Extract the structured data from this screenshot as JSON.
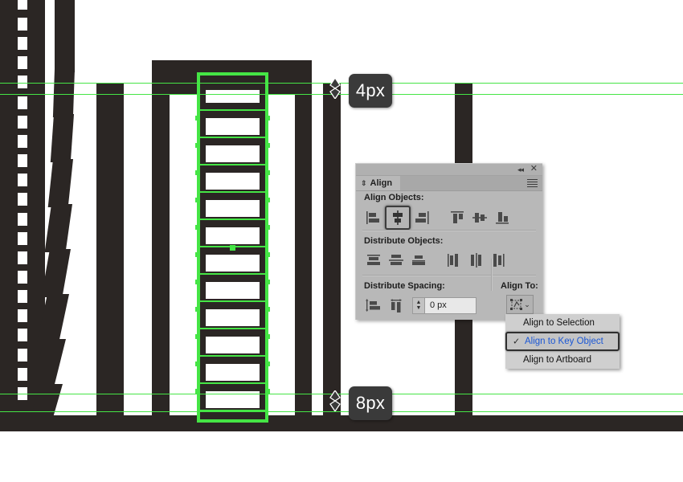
{
  "app": {
    "canvas_background": "#ffffff",
    "artwork_color": "#2b2624",
    "guide_color": "#45e545",
    "selection_color": "#45e545",
    "panel_background": "#b8b8b8",
    "highlight_text_color": "#1a57d6"
  },
  "measurements": [
    {
      "id": "top-gap",
      "value": "4px",
      "icon": "vertical-double-arrow-icon"
    },
    {
      "id": "bottom-gap",
      "value": "8px",
      "icon": "vertical-double-arrow-icon"
    }
  ],
  "panel": {
    "title": "Align",
    "collapse_icon": "collapse-double-chevron-icon",
    "close_icon": "close-icon",
    "menu_icon": "panel-menu-icon",
    "sections": {
      "align_objects": {
        "label": "Align Objects:",
        "buttons": [
          {
            "name": "horizontal-align-left",
            "icon": "align-left-icon",
            "active": false
          },
          {
            "name": "horizontal-align-center",
            "icon": "align-horizontal-center-icon",
            "active": true
          },
          {
            "name": "horizontal-align-right",
            "icon": "align-right-icon",
            "active": false
          },
          {
            "name": "vertical-align-top",
            "icon": "align-top-icon",
            "active": false
          },
          {
            "name": "vertical-align-center",
            "icon": "align-vertical-center-icon",
            "active": false
          },
          {
            "name": "vertical-align-bottom",
            "icon": "align-bottom-icon",
            "active": false
          }
        ]
      },
      "distribute_objects": {
        "label": "Distribute Objects:",
        "buttons": [
          {
            "name": "vertical-distribute-top",
            "icon": "distribute-top-icon"
          },
          {
            "name": "vertical-distribute-center",
            "icon": "distribute-vertical-center-icon"
          },
          {
            "name": "vertical-distribute-bottom",
            "icon": "distribute-bottom-icon"
          },
          {
            "name": "horizontal-distribute-left",
            "icon": "distribute-left-icon"
          },
          {
            "name": "horizontal-distribute-center",
            "icon": "distribute-horizontal-center-icon"
          },
          {
            "name": "horizontal-distribute-right",
            "icon": "distribute-right-icon"
          }
        ]
      },
      "distribute_spacing": {
        "label": "Distribute Spacing:",
        "buttons": [
          {
            "name": "vertical-distribute-spacing",
            "icon": "vertical-spacing-icon"
          },
          {
            "name": "horizontal-distribute-spacing",
            "icon": "horizontal-spacing-icon"
          }
        ],
        "spacing_value": "0 px",
        "spacing_placeholder": "0 px",
        "stepper_up": "▲",
        "stepper_down": "▼"
      },
      "align_to": {
        "label": "Align To:",
        "button_icon": "align-to-key-object-icon",
        "chevron": "⌄"
      }
    }
  },
  "dropdown": {
    "check_glyph": "✓",
    "items": [
      {
        "label": "Align to Selection",
        "selected": false,
        "checked": false
      },
      {
        "label": "Align to Key Object",
        "selected": true,
        "checked": true
      },
      {
        "label": "Align to Artboard",
        "selected": false,
        "checked": false
      }
    ]
  },
  "artwork": {
    "description": "building-illustration-with-window-rows",
    "selected_windows": 13
  }
}
